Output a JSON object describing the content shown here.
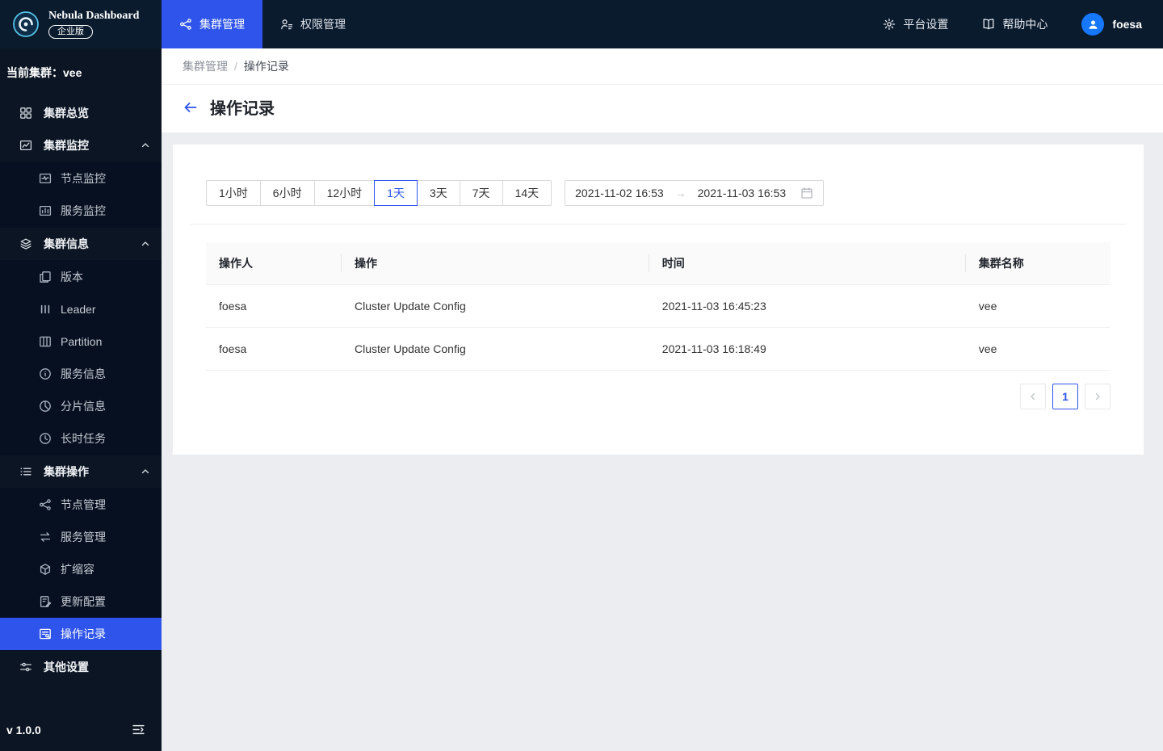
{
  "colors": {
    "primary": "#2f54eb",
    "topbar_bg": "#0a1b2e",
    "sidebar_bg": "#0b1523",
    "avatar_bg": "#1677ff"
  },
  "topbar": {
    "brand": {
      "title": "Nebula Dashboard",
      "badge": "企业版"
    },
    "tabs": [
      {
        "label": "集群管理",
        "icon": "cluster-icon",
        "active": true
      },
      {
        "label": "权限管理",
        "icon": "permission-icon",
        "active": false
      }
    ],
    "links": [
      {
        "label": "平台设置",
        "icon": "gear-icon"
      },
      {
        "label": "帮助中心",
        "icon": "help-icon"
      }
    ],
    "user": {
      "name": "foesa"
    }
  },
  "sidebar": {
    "current_cluster": {
      "label": "当前集群：",
      "value": "vee"
    },
    "menu": [
      {
        "type": "item",
        "label": "集群总览",
        "icon": "overview-icon"
      },
      {
        "type": "group",
        "label": "集群监控",
        "icon": "monitor-icon",
        "expanded": true,
        "children": [
          {
            "label": "节点监控",
            "icon": "node-monitor-icon"
          },
          {
            "label": "服务监控",
            "icon": "service-monitor-icon"
          }
        ]
      },
      {
        "type": "group",
        "label": "集群信息",
        "icon": "cluster-info-icon",
        "expanded": true,
        "children": [
          {
            "label": "版本",
            "icon": "version-icon"
          },
          {
            "label": "Leader",
            "icon": "leader-icon"
          },
          {
            "label": "Partition",
            "icon": "partition-icon"
          },
          {
            "label": "服务信息",
            "icon": "service-info-icon"
          },
          {
            "label": "分片信息",
            "icon": "shard-info-icon"
          },
          {
            "label": "长时任务",
            "icon": "long-task-icon"
          }
        ]
      },
      {
        "type": "group",
        "label": "集群操作",
        "icon": "cluster-operation-icon",
        "expanded": true,
        "children": [
          {
            "label": "节点管理",
            "icon": "node-manage-icon"
          },
          {
            "label": "服务管理",
            "icon": "service-manage-icon"
          },
          {
            "label": "扩缩容",
            "icon": "scale-icon"
          },
          {
            "label": "更新配置",
            "icon": "update-config-icon"
          },
          {
            "label": "操作记录",
            "icon": "operation-record-icon",
            "active": true
          }
        ]
      },
      {
        "type": "item",
        "label": "其他设置",
        "icon": "other-settings-icon"
      }
    ],
    "version": "v 1.0.0"
  },
  "main": {
    "breadcrumb": [
      "集群管理",
      "操作记录"
    ],
    "breadcrumb_separator": "/",
    "page_title": "操作记录",
    "filters": {
      "options": [
        "1小时",
        "6小时",
        "12小时",
        "1天",
        "3天",
        "7天",
        "14天"
      ],
      "active_index": 3
    },
    "date_range": {
      "start": "2021-11-02 16:53",
      "end": "2021-11-03 16:53",
      "separator": "→"
    },
    "table": {
      "headers": [
        "操作人",
        "操作",
        "时间",
        "集群名称"
      ],
      "col_widths": [
        "15%",
        "34%",
        "35%",
        "16%"
      ],
      "rows": [
        [
          "foesa",
          "Cluster Update Config",
          "2021-11-03 16:45:23",
          "vee"
        ],
        [
          "foesa",
          "Cluster Update Config",
          "2021-11-03 16:18:49",
          "vee"
        ]
      ]
    },
    "pagination": {
      "current": "1"
    }
  }
}
